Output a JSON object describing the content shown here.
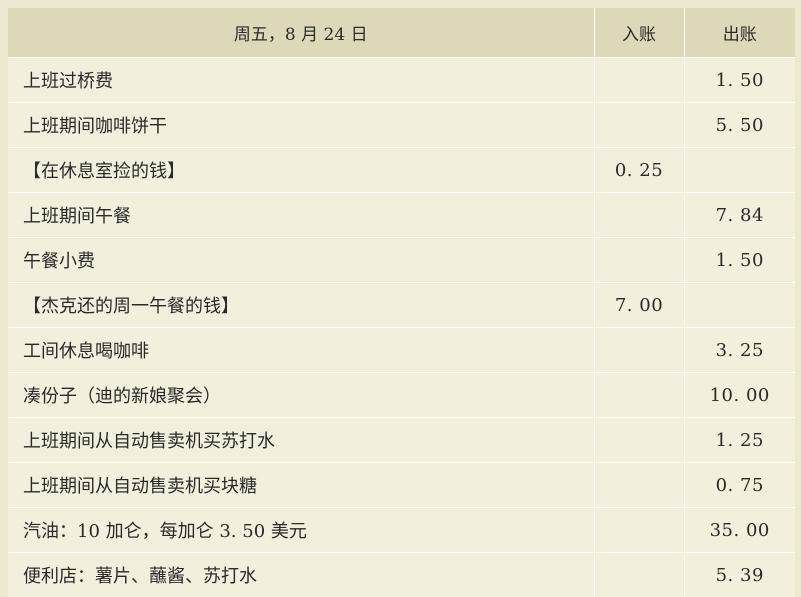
{
  "header": {
    "date": "周五，8 月 24 日",
    "income": "入账",
    "expense": "出账"
  },
  "rows": [
    {
      "desc": "上班过桥费",
      "in": "",
      "out": "1. 50"
    },
    {
      "desc": "上班期间咖啡饼干",
      "in": "",
      "out": "5. 50"
    },
    {
      "desc": "【在休息室捡的钱】",
      "in": "0. 25",
      "out": ""
    },
    {
      "desc": "上班期间午餐",
      "in": "",
      "out": "7. 84"
    },
    {
      "desc": "午餐小费",
      "in": "",
      "out": "1. 50"
    },
    {
      "desc": "【杰克还的周一午餐的钱】",
      "in": "7. 00",
      "out": ""
    },
    {
      "desc": "工间休息喝咖啡",
      "in": "",
      "out": "3. 25"
    },
    {
      "desc": "凑份子（迪的新娘聚会）",
      "in": "",
      "out": "10. 00"
    },
    {
      "desc": "上班期间从自动售卖机买苏打水",
      "in": "",
      "out": "1. 25"
    },
    {
      "desc": "上班期间从自动售卖机买块糖",
      "in": "",
      "out": "0. 75"
    },
    {
      "desc": "汽油：10 加仑，每加仑 3. 50 美元",
      "in": "",
      "out": "35. 00"
    },
    {
      "desc": "便利店：薯片、蘸酱、苏打水",
      "in": "",
      "out": "5. 39"
    }
  ]
}
